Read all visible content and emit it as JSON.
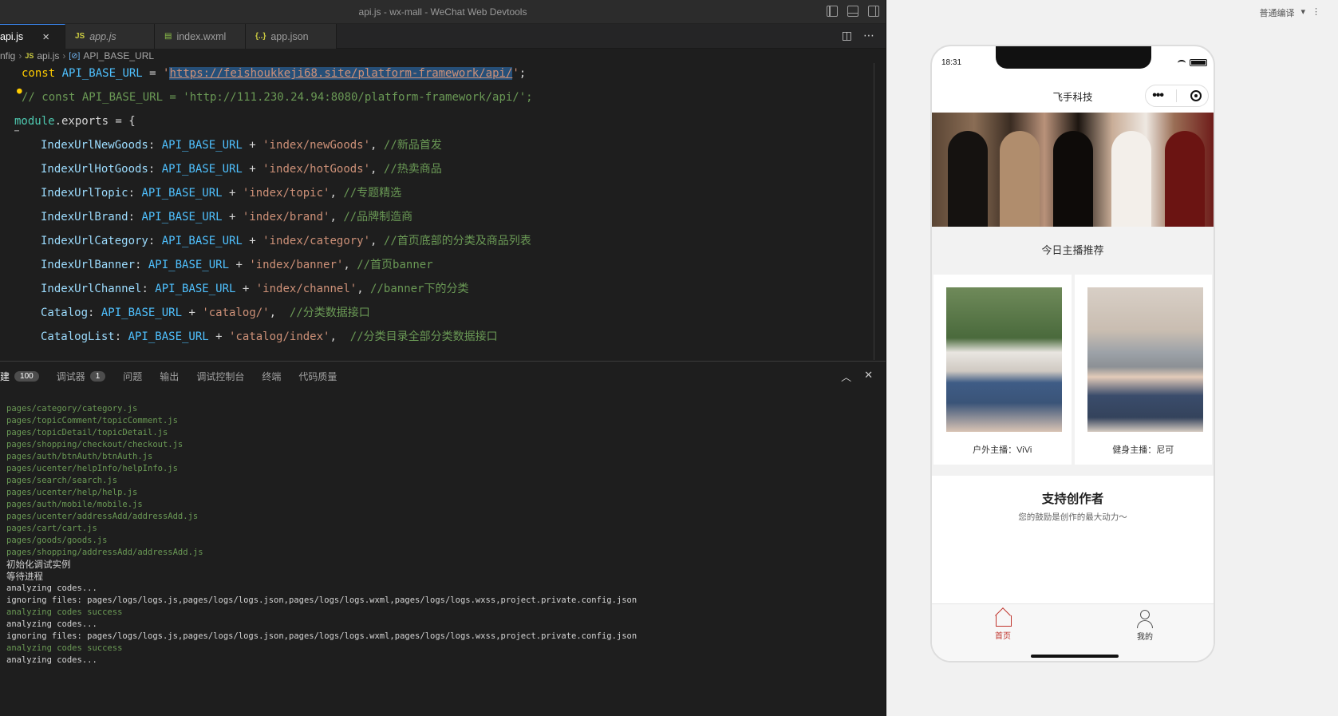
{
  "window": {
    "title": "api.js - wx-mall - WeChat Web Devtools"
  },
  "tabs": [
    {
      "label": "api.js",
      "type": "js"
    },
    {
      "label": "app.js",
      "type": "js"
    },
    {
      "label": "index.wxml",
      "type": "wxml"
    },
    {
      "label": "app.json",
      "type": "json"
    }
  ],
  "breadcrumb": {
    "part1": "nfig",
    "part2": "api.js",
    "part3": "API_BASE_URL"
  },
  "code": {
    "line1": {
      "kw": "const",
      "name": "API_BASE_URL",
      "eq": " = ",
      "q1": "'",
      "url": "https://feishoukkeji68.site/platform-framework/api/",
      "q2": "'",
      "end": ";"
    },
    "line2": "// const API_BASE_URL = 'http://111.230.24.94:8080/platform-framework/api/';",
    "line3": {
      "mod": "module",
      "rest": ".exports = {"
    },
    "entries": [
      {
        "prop": "IndexUrlNewGoods",
        "str": "'index/newGoods'",
        "cm": "//新品首发"
      },
      {
        "prop": "IndexUrlHotGoods",
        "str": "'index/hotGoods'",
        "cm": "//热卖商品"
      },
      {
        "prop": "IndexUrlTopic",
        "str": "'index/topic'",
        "cm": "//专题精选"
      },
      {
        "prop": "IndexUrlBrand",
        "str": "'index/brand'",
        "cm": "//品牌制造商"
      },
      {
        "prop": "IndexUrlCategory",
        "str": "'index/category'",
        "cm": "//首页底部的分类及商品列表"
      },
      {
        "prop": "IndexUrlBanner",
        "str": "'index/banner'",
        "cm": "//首页banner"
      },
      {
        "prop": "IndexUrlChannel",
        "str": "'index/channel'",
        "cm": "//banner下的分类"
      },
      {
        "prop": "Catalog",
        "str": "'catalog/'",
        "cm": "//分类数据接口"
      },
      {
        "prop": "CatalogList",
        "str": "'catalog/index'",
        "cm": "//分类目录全部分类数据接口"
      }
    ],
    "const_name": "API_BASE_URL"
  },
  "panel": {
    "tabs": [
      {
        "label": "建",
        "badge": "100"
      },
      {
        "label": "调试器",
        "badge": "1"
      },
      {
        "label": "问题"
      },
      {
        "label": "输出"
      },
      {
        "label": "调试控制台"
      },
      {
        "label": "终端"
      },
      {
        "label": "代码质量"
      }
    ],
    "logs": [
      {
        "t": "pages/category/category.js",
        "c": "g"
      },
      {
        "t": "pages/topicComment/topicComment.js",
        "c": "g"
      },
      {
        "t": "pages/topicDetail/topicDetail.js",
        "c": "g"
      },
      {
        "t": "pages/shopping/checkout/checkout.js",
        "c": "g"
      },
      {
        "t": "pages/auth/btnAuth/btnAuth.js",
        "c": "g"
      },
      {
        "t": "pages/ucenter/helpInfo/helpInfo.js",
        "c": "g"
      },
      {
        "t": "pages/search/search.js",
        "c": "g"
      },
      {
        "t": "pages/ucenter/help/help.js",
        "c": "g"
      },
      {
        "t": "pages/auth/mobile/mobile.js",
        "c": "g"
      },
      {
        "t": "pages/ucenter/addressAdd/addressAdd.js",
        "c": "g"
      },
      {
        "t": "pages/cart/cart.js",
        "c": "g"
      },
      {
        "t": "pages/goods/goods.js",
        "c": "g"
      },
      {
        "t": "pages/shopping/addressAdd/addressAdd.js",
        "c": "g"
      },
      {
        "t": "初始化调试实例",
        "c": "cjk"
      },
      {
        "t": "等待进程",
        "c": "cjk"
      },
      {
        "t": "analyzing codes...",
        "c": "w"
      },
      {
        "t": "ignoring files: pages/logs/logs.js,pages/logs/logs.json,pages/logs/logs.wxml,pages/logs/logs.wxss,project.private.config.json",
        "c": "w"
      },
      {
        "t": "analyzing codes success",
        "c": "g"
      },
      {
        "t": "analyzing codes...",
        "c": "w"
      },
      {
        "t": "ignoring files: pages/logs/logs.js,pages/logs/logs.json,pages/logs/logs.wxml,pages/logs/logs.wxss,project.private.config.json",
        "c": "w"
      },
      {
        "t": "analyzing codes success",
        "c": "g"
      },
      {
        "t": "analyzing codes...",
        "c": "w"
      }
    ]
  },
  "simulator": {
    "compile_mode": "普通编译",
    "time": "18:31",
    "nav_title": "飞手科技",
    "section_title": "今日主播推荐",
    "cards": [
      {
        "caption": "户外主播：ViVi"
      },
      {
        "caption": "健身主播：尼可"
      }
    ],
    "support_title": "支持创作者",
    "support_sub": "您的鼓励是创作的最大动力～",
    "tabbar": [
      {
        "label": "首页",
        "icon": "home-icon"
      },
      {
        "label": "我的",
        "icon": "user-icon"
      }
    ]
  }
}
